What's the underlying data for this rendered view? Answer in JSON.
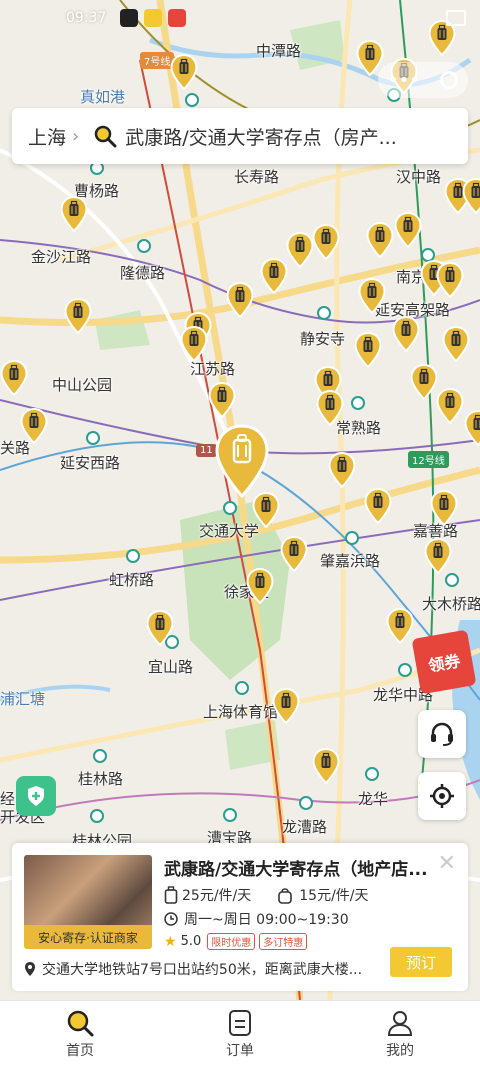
{
  "status_bar": {
    "time": "09:37"
  },
  "map": {
    "labels": [
      {
        "text": "中潭路"
      },
      {
        "text": "真如港"
      },
      {
        "text": "曹杨路"
      },
      {
        "text": "长寿路"
      },
      {
        "text": "汉中路"
      },
      {
        "text": "金沙江路"
      },
      {
        "text": "隆德路"
      },
      {
        "text": "南京"
      },
      {
        "text": "延安高架路"
      },
      {
        "text": "静安寺"
      },
      {
        "text": "中山公园"
      },
      {
        "text": "江苏路"
      },
      {
        "text": "常熟路"
      },
      {
        "text": "延安西路"
      },
      {
        "text": "关路"
      },
      {
        "text": "交通大学"
      },
      {
        "text": "嘉善路"
      },
      {
        "text": "虹桥路"
      },
      {
        "text": "肇嘉浜路"
      },
      {
        "text": "徐家汇"
      },
      {
        "text": "大木桥路"
      },
      {
        "text": "宜山路"
      },
      {
        "text": "龙华中路"
      },
      {
        "text": "上海体育馆"
      },
      {
        "text": "浦汇塘"
      },
      {
        "text": "桂林路"
      },
      {
        "text": "龙华"
      },
      {
        "text": "桂林公园"
      },
      {
        "text": "漕宝路"
      },
      {
        "text": "龙漕路"
      },
      {
        "text": "经"
      },
      {
        "text": "开发区"
      }
    ],
    "line_tags": [
      {
        "text": "7号线"
      },
      {
        "text": "12号线"
      },
      {
        "text": "11"
      }
    ]
  },
  "search": {
    "city": "上海",
    "query": "武康路/交通大学寄存点（房产..."
  },
  "promo": {
    "label": "领券"
  },
  "card": {
    "title": "武康路/交通大学寄存点（地产店...",
    "badge": "安心寄存·认证商家",
    "price_large": "25元/件/天",
    "price_small": "15元/件/天",
    "hours": "周一~周日 09:00~19:30",
    "rating": "5.0",
    "tags": [
      "限时优惠",
      "多订特惠"
    ],
    "address": "交通大学地铁站7号口出站约50米，距离武康大楼...",
    "book_label": "预订"
  },
  "tabs": [
    {
      "label": "首页"
    },
    {
      "label": "订单"
    },
    {
      "label": "我的"
    }
  ],
  "colors": {
    "accent": "#f3c833",
    "pin": "#e8b93a",
    "promo": "#e5453a"
  }
}
